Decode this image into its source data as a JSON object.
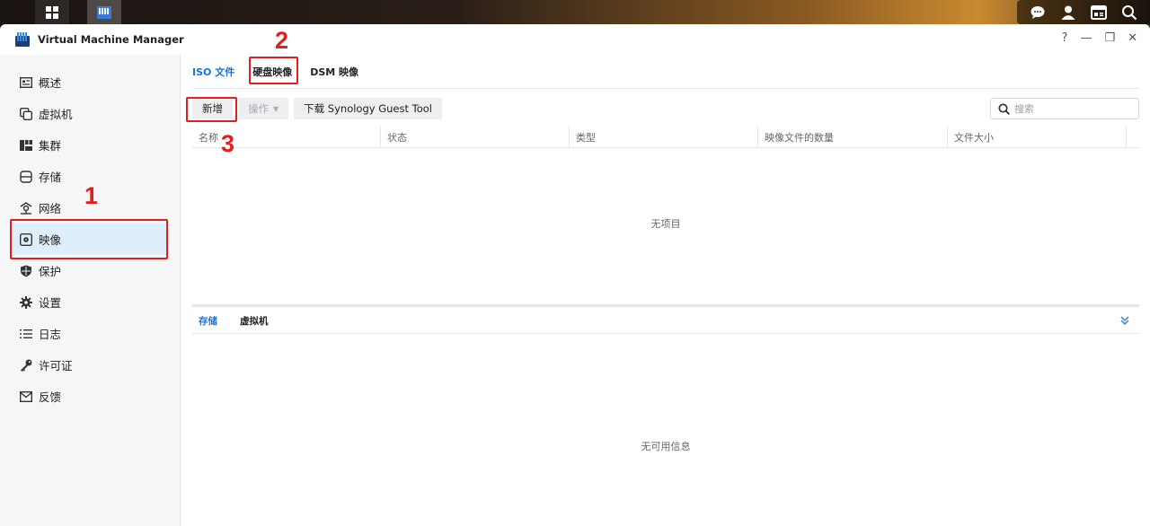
{
  "window": {
    "title": "Virtual Machine Manager"
  },
  "window_controls": {
    "help": "?",
    "minimize": "—",
    "restore": "❐",
    "close": "✕"
  },
  "sidebar": {
    "items": [
      {
        "label": "概述",
        "icon": "overview-icon"
      },
      {
        "label": "虚拟机",
        "icon": "vm-icon"
      },
      {
        "label": "集群",
        "icon": "cluster-icon"
      },
      {
        "label": "存储",
        "icon": "storage-icon"
      },
      {
        "label": "网络",
        "icon": "network-icon"
      },
      {
        "label": "映像",
        "icon": "image-icon",
        "active": true
      },
      {
        "label": "保护",
        "icon": "shield-icon"
      },
      {
        "label": "设置",
        "icon": "gear-icon"
      },
      {
        "label": "日志",
        "icon": "log-icon"
      },
      {
        "label": "许可证",
        "icon": "key-icon"
      },
      {
        "label": "反馈",
        "icon": "mail-icon"
      }
    ]
  },
  "tabs": [
    {
      "label": "ISO 文件",
      "active": true
    },
    {
      "label": "硬盘映像",
      "active": false
    },
    {
      "label": "DSM 映像",
      "active": false
    }
  ],
  "toolbar": {
    "add_label": "新增",
    "action_label": "操作",
    "download_label": "下载 Synology Guest Tool",
    "search_placeholder": "搜索"
  },
  "grid": {
    "columns": [
      "名称",
      "状态",
      "类型",
      "映像文件的数量",
      "文件大小"
    ],
    "empty_text": "无项目"
  },
  "detail_tabs": [
    {
      "label": "存储",
      "active": true
    },
    {
      "label": "虚拟机",
      "active": false
    }
  ],
  "detail_empty_text": "无可用信息",
  "annotations": [
    "1",
    "2",
    "3"
  ],
  "colors": {
    "accent": "#1a73d9",
    "annotation": "#e02020",
    "active_bg": "#dfeefb"
  }
}
